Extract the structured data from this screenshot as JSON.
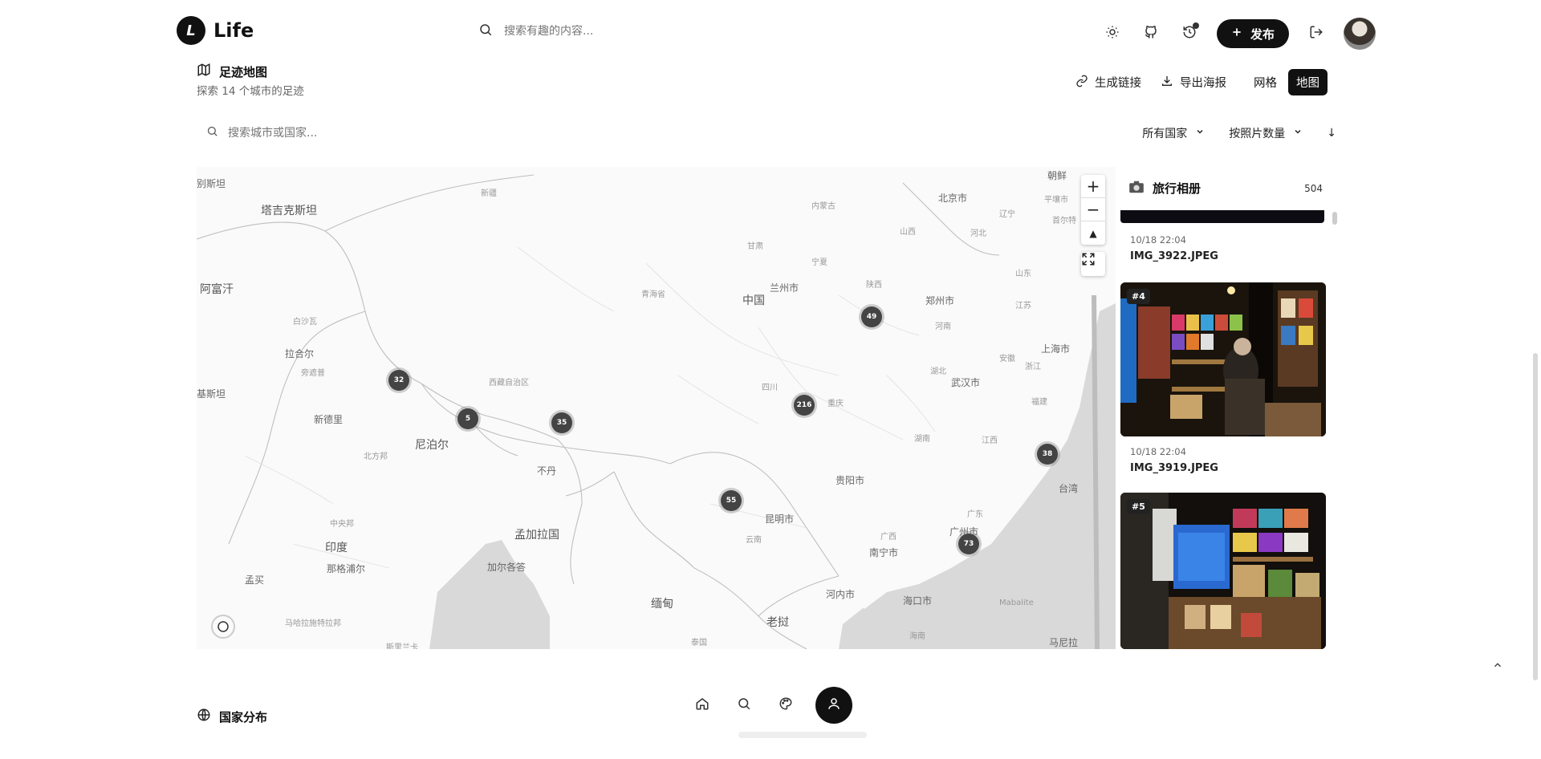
{
  "header": {
    "logo_letter": "L",
    "logo_text": "Life",
    "search_placeholder": "搜索有趣的内容...",
    "publish_label": "发布"
  },
  "section": {
    "title": "足迹地图",
    "subtitle": "探索 14 个城市的足迹",
    "generate_link_label": "生成链接",
    "export_poster_label": "导出海报",
    "view_grid_label": "网格",
    "view_map_label": "地图"
  },
  "filters": {
    "city_search_placeholder": "搜索城市或国家...",
    "country_select": "所有国家",
    "sort_select": "按照片数量",
    "order_icon": "↓"
  },
  "map": {
    "labels_large": [
      "塔吉克斯坦",
      "阿富汗",
      "中国",
      "尼泊尔",
      "印度",
      "孟加拉国",
      "缅甸",
      "老挝",
      "北京市",
      "兰州市",
      "郑州市",
      "上海市",
      "武汉市",
      "贵阳市",
      "昆明市",
      "南宁市",
      "广州市",
      "台湾",
      "河内市",
      "海口市",
      "新德里",
      "拉合尔",
      "不丹",
      "加尔各答",
      "那格浦尔",
      "孟买",
      "朝鲜",
      "平壤市",
      "首尔特",
      "马尼拉",
      "Mabalite",
      "别斯坦",
      "基斯坦"
    ],
    "labels_small": [
      "新疆",
      "甘肃",
      "青海省",
      "西藏自治区",
      "四川",
      "重庆",
      "陕西",
      "山西",
      "河南",
      "湖北",
      "湖南",
      "江西",
      "安徽",
      "江苏",
      "浙江",
      "福建",
      "广西",
      "广东",
      "云南",
      "海南",
      "河北",
      "山东",
      "辽宁",
      "宁夏",
      "内蒙古",
      "白沙瓦",
      "旁遮普",
      "北方邦",
      "中央邦",
      "马哈拉施特拉邦",
      "斯里兰卡",
      "泰国"
    ],
    "clusters": [
      {
        "count": "32"
      },
      {
        "count": "5"
      },
      {
        "count": "35"
      },
      {
        "count": "49"
      },
      {
        "count": "216"
      },
      {
        "count": "55"
      },
      {
        "count": "73"
      },
      {
        "count": "38"
      }
    ]
  },
  "album": {
    "title": "旅行相册",
    "count": "504",
    "photos": [
      {
        "badge": "",
        "timestamp": "10/18 22:04",
        "filename": "IMG_3922.JPEG"
      },
      {
        "badge": "#4",
        "timestamp": "10/18 22:04",
        "filename": "IMG_3919.JPEG"
      },
      {
        "badge": "#5",
        "timestamp": "",
        "filename": ""
      }
    ]
  },
  "bottom": {
    "country_section_title": "国家分布"
  },
  "colors": {
    "accent": "#111111",
    "map_bg": "#fafafa",
    "water": "#d9d9d9",
    "cluster": "#444444"
  }
}
